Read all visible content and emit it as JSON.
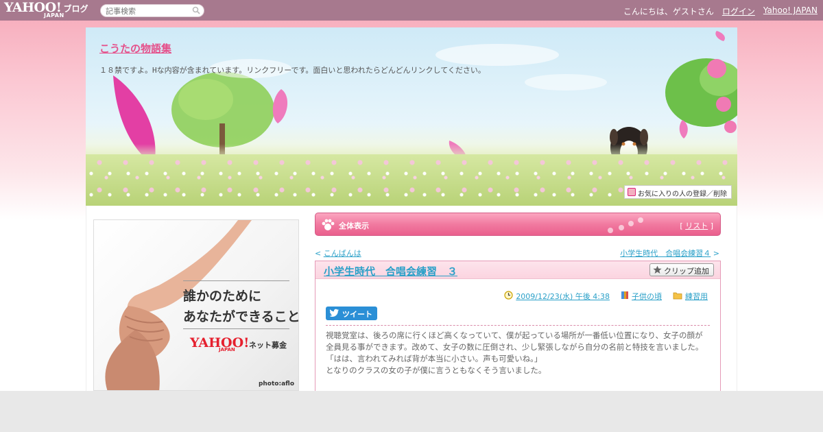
{
  "topbar": {
    "logo_text": "YAHOO!",
    "logo_sub": "JAPAN",
    "blog_label": "ブログ",
    "search_placeholder": "記事検索",
    "greeting": "こんにちは、ゲストさん",
    "login": "ログイン",
    "yahoo_japan": "Yahoo! JAPAN"
  },
  "header": {
    "blog_title": "こうたの物語集",
    "description": "１８禁ですよ。Hな内容が含まれています。リンクフリーです。面白いと思われたらどんどんリンクしてください。",
    "favorite_button": "お気に入りの人の登録／削除"
  },
  "ad": {
    "headline": "誰かのために\nあなたができること",
    "logo_text": "YAHOO!",
    "logo_sub": "JAPAN",
    "sub": "ネット募金",
    "credit": "photo:aflo"
  },
  "category_bar": {
    "label": "全体表示",
    "list_open": "[",
    "list_link": "リスト",
    "list_close": "]"
  },
  "navigation": {
    "prev_marker": "<",
    "prev": "こんばんは",
    "next": "小学生時代　合唱会練習４",
    "next_marker": ">"
  },
  "article": {
    "title": "小学生時代　合唱会練習　３",
    "clip_button": "クリップ追加",
    "date": "2009/12/23(水) 午後 4:38",
    "category1": "子供の頃",
    "category2": "練習用",
    "tweet": "ツイート",
    "paragraphs": [
      "視聴覚室は、後ろの席に行くほど高くなっていて、僕が起っている場所が一番低い位置になり、女子の顔が全員見る事ができます。改めて、女子の数に圧倒され、少し緊張しながら自分の名前と特技を言いました。",
      "「はは、言われてみれば背が本当に小さい。声も可愛いね。」",
      "となりのクラスの女の子が僕に言うともなくそう言いました。"
    ]
  },
  "colors": {
    "topbar": "#a7798e",
    "accent_pink": "#e5508a",
    "link": "#2aa0c8"
  }
}
